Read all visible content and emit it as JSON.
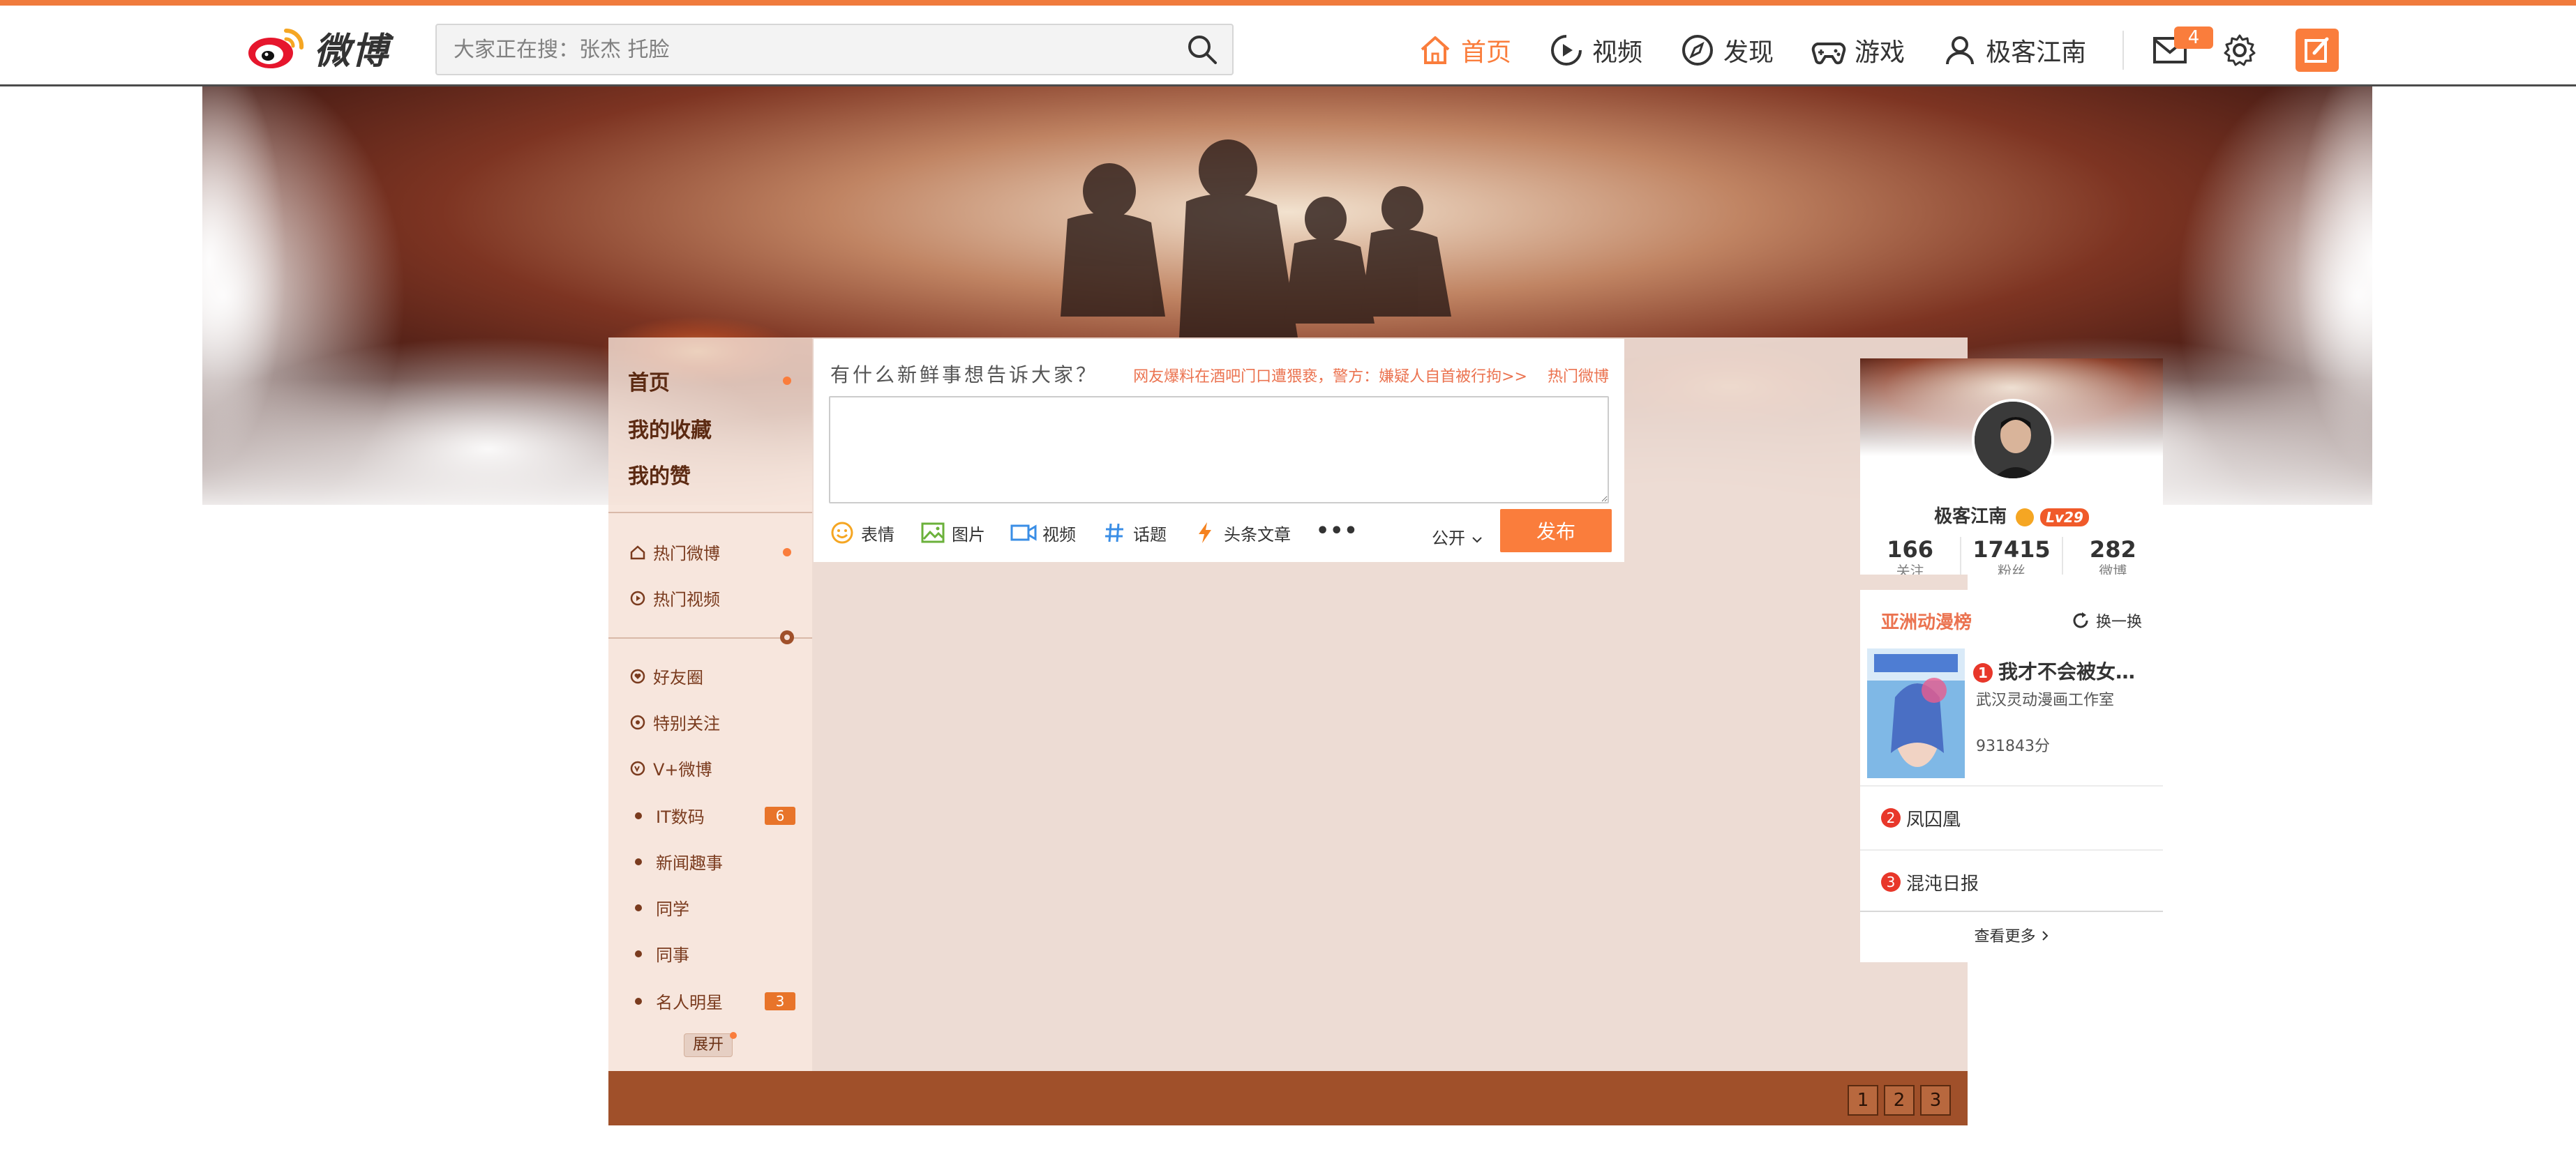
{
  "header": {
    "logo_text": "微博",
    "search_placeholder": "大家正在搜：张杰 托脸",
    "nav": [
      {
        "label": "首页",
        "icon": "home-icon",
        "active": true
      },
      {
        "label": "视频",
        "icon": "video-play-icon",
        "active": false
      },
      {
        "label": "发现",
        "icon": "compass-icon",
        "active": false
      },
      {
        "label": "游戏",
        "icon": "gamepad-icon",
        "active": false
      },
      {
        "label": "极客江南",
        "icon": "user-icon",
        "active": false
      }
    ],
    "message_count": "4"
  },
  "sidebar": {
    "primary": [
      "首页",
      "我的收藏",
      "我的赞"
    ],
    "hot": [
      "热门微博",
      "热门视频"
    ],
    "groups": [
      "好友圈",
      "特别关注",
      "V+微博"
    ],
    "tags": [
      {
        "label": "IT数码",
        "count": "6"
      },
      {
        "label": "新闻趣事",
        "count": ""
      },
      {
        "label": "同学",
        "count": ""
      },
      {
        "label": "同事",
        "count": ""
      },
      {
        "label": "名人明星",
        "count": "3"
      }
    ],
    "expand": "展开"
  },
  "composer": {
    "prompt": "有什么新鲜事想告诉大家？",
    "hot_news": "网友爆料在酒吧门口遭猥亵，警方：嫌疑人自首被行拘>>",
    "hot_link": "热门微博",
    "tools": [
      "表情",
      "图片",
      "视频",
      "话题",
      "头条文章"
    ],
    "more": "•••",
    "privacy": "公开",
    "publish": "发布"
  },
  "profile": {
    "name": "极客江南",
    "level": "Lv29",
    "stats": [
      {
        "num": "166",
        "label": "关注"
      },
      {
        "num": "17415",
        "label": "粉丝"
      },
      {
        "num": "282",
        "label": "微博"
      }
    ]
  },
  "ranking": {
    "title": "亚洲动漫榜",
    "refresh": "换一换",
    "top": {
      "rank": "1",
      "title": "我才不会被女…",
      "studio": "武汉灵动漫画工作室",
      "score": "931843分"
    },
    "items": [
      {
        "rank": "2",
        "title": "凤囚凰"
      },
      {
        "rank": "3",
        "title": "混沌日报"
      }
    ],
    "see_more": "查看更多"
  },
  "footer": {
    "pages": [
      "1",
      "2",
      "3"
    ]
  },
  "colors": {
    "accent": "#fa7d3c",
    "footer": "#a0502a",
    "hot_text": "#eb7350"
  }
}
